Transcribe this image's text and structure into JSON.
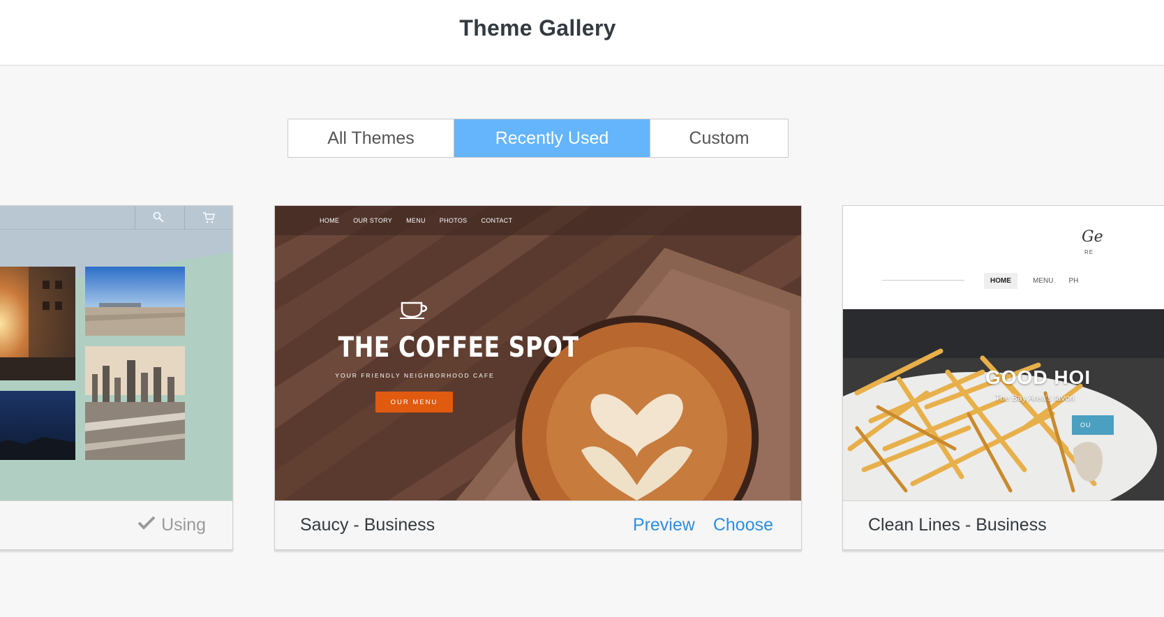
{
  "header": {
    "title": "Theme Gallery"
  },
  "tabs": [
    {
      "label": "All Themes",
      "active": false
    },
    {
      "label": "Recently Used",
      "active": true
    },
    {
      "label": "Custom",
      "active": false
    }
  ],
  "colors": {
    "accent": "#64b5fb",
    "link": "#2f8ee0",
    "cta_orange": "#e05a10"
  },
  "cards": [
    {
      "name": "",
      "status_label": "Using",
      "status_icon": "checkmark-icon",
      "toolbar_icons": [
        "search-icon",
        "cart-icon"
      ]
    },
    {
      "name": "Saucy - Business",
      "preview_label": "Preview",
      "choose_label": "Choose",
      "thumb": {
        "nav": [
          "HOME",
          "OUR STORY",
          "MENU",
          "PHOTOS",
          "CONTACT"
        ],
        "title": "THE COFFEE SPOT",
        "subtitle": "YOUR FRIENDLY NEIGHBORHOOD CAFE",
        "button": "OUR MENU",
        "icon": "coffee-cup-icon"
      }
    },
    {
      "name": "Clean Lines - Business",
      "thumb": {
        "logo": "Ge",
        "logo_sub": "RE",
        "nav": [
          "HOME",
          "MENU",
          "PH"
        ],
        "headline": "GOOD HOI",
        "subline": "The Bay Area's favori",
        "button": "OU"
      }
    }
  ]
}
